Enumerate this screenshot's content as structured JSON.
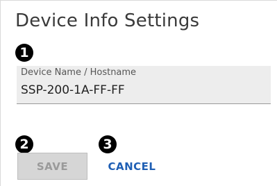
{
  "page": {
    "title": "Device Info Settings"
  },
  "callouts": {
    "one": "1",
    "two": "2",
    "three": "3"
  },
  "form": {
    "device_name_label": "Device Name / Hostname",
    "device_name_value": "SSP-200-1A-FF-FF"
  },
  "actions": {
    "save_label": "SAVE",
    "cancel_label": "CANCEL"
  },
  "colors": {
    "accent": "#1f5fb4",
    "disabled_button": "#d6d6d6",
    "field_background": "#ededed"
  }
}
